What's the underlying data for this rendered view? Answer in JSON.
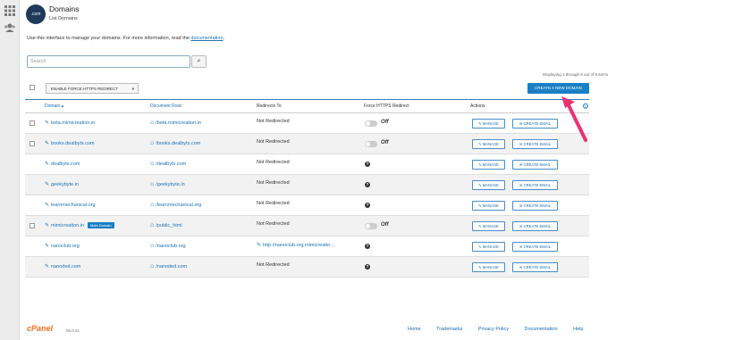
{
  "header": {
    "logo_text": ".com",
    "title": "Domains",
    "subtitle": "List Domains"
  },
  "description": {
    "text": "Use this interface to manage your domains. For more information, read the ",
    "link": "documentation",
    "end": "."
  },
  "search": {
    "placeholder": "Search",
    "value": ""
  },
  "pagination": {
    "text": "Displaying 1 through 8 out of 8 items"
  },
  "bulk_action": {
    "label": "ENABLE FORCE HTTPS REDIRECT",
    "caret": "▾"
  },
  "create_button": {
    "label": "CREATE A NEW DOMAIN"
  },
  "table": {
    "headers": {
      "domain": "Domain ▴",
      "docroot": "Document Root",
      "redirects": "Redirects To",
      "https": "Force HTTPS Redirect",
      "actions": "Actions"
    },
    "rows": [
      {
        "domain": "beta.mimicreation.in",
        "docroot": "/beta.mimicreation.in",
        "redirect": "Not Redirected",
        "toggle": "off",
        "off_label": "Off",
        "checkbox": true,
        "badge": "",
        "redirect_link": false
      },
      {
        "domain": "books.dealbyts.com",
        "docroot": "/books.dealbyts.com",
        "redirect": "Not Redirected",
        "toggle": "off",
        "off_label": "Off",
        "checkbox": true,
        "badge": "",
        "redirect_link": false
      },
      {
        "domain": "dealbyts.com",
        "docroot": "/dealbyts.com",
        "redirect": "Not Redirected",
        "toggle": "help",
        "off_label": "",
        "checkbox": false,
        "badge": "",
        "redirect_link": false
      },
      {
        "domain": "geekybyte.in",
        "docroot": "/geekybyte.in",
        "redirect": "Not Redirected",
        "toggle": "help",
        "off_label": "",
        "checkbox": false,
        "badge": "",
        "redirect_link": false
      },
      {
        "domain": "learnmechanical.org",
        "docroot": "/learnmechanical.org",
        "redirect": "Not Redirected",
        "toggle": "help",
        "off_label": "",
        "checkbox": false,
        "badge": "",
        "redirect_link": false
      },
      {
        "domain": "mimicreation.in",
        "docroot": "/public_html",
        "redirect": "Not Redirected",
        "toggle": "off",
        "off_label": "Off",
        "checkbox": true,
        "badge": "Main Domain",
        "redirect_link": false
      },
      {
        "domain": "nanoclub.org",
        "docroot": "/nanoclub.org",
        "redirect": "http://nanoclub.org.mimicreatio...",
        "toggle": "help",
        "off_label": "",
        "checkbox": false,
        "badge": "",
        "redirect_link": true
      },
      {
        "domain": "nanoded.com",
        "docroot": "/nanoded.com",
        "redirect": "Not Redirected",
        "toggle": "help",
        "off_label": "",
        "checkbox": false,
        "badge": "",
        "redirect_link": false
      }
    ],
    "manage_label": "✎ MANAGE",
    "email_label": "✉ CREATE EMAIL"
  },
  "footer": {
    "logo": "cPanel",
    "version": "86.0.21",
    "links": [
      "Home",
      "Trademarks",
      "Privacy Policy",
      "Documentation",
      "Help"
    ]
  },
  "colors": {
    "accent": "#1a7fc4",
    "arrow": "#e8336e",
    "cpanel_orange": "#f37021"
  },
  "icons": {
    "grid": "grid-icon",
    "users": "users-icon",
    "edit": "edit-icon",
    "home": "home-icon",
    "gear": "gear-icon",
    "search": "search-icon"
  }
}
